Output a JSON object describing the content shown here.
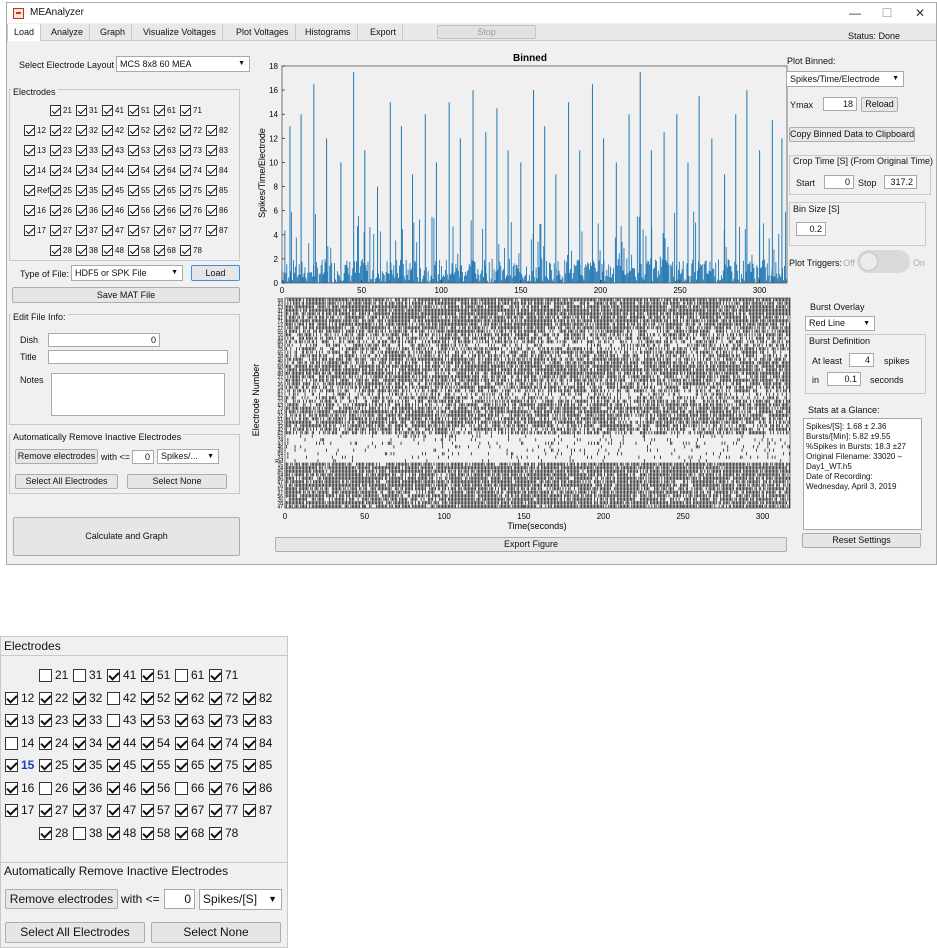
{
  "window": {
    "title": "MEAnalyzer",
    "minimize": "—",
    "maximize": "☐",
    "close": "✕",
    "status": "Status: Done",
    "stop_label": "Stop",
    "tabs": [
      "Load",
      "Analyze",
      "Graph",
      "Visualize Voltages",
      "Plot Voltages",
      "Histograms",
      "Export"
    ]
  },
  "left": {
    "layout_label": "Select Electrode Layout",
    "layout_value": "MCS 8x8 60 MEA",
    "electrodes_title": "Electrodes",
    "electrode_rows": [
      [
        {
          "l": "21",
          "c": true
        },
        {
          "l": "31",
          "c": true
        },
        {
          "l": "41",
          "c": true
        },
        {
          "l": "51",
          "c": true
        },
        {
          "l": "61",
          "c": true
        },
        {
          "l": "71",
          "c": true
        }
      ],
      [
        {
          "l": "12",
          "c": true
        },
        {
          "l": "22",
          "c": true
        },
        {
          "l": "32",
          "c": true
        },
        {
          "l": "42",
          "c": true
        },
        {
          "l": "52",
          "c": true
        },
        {
          "l": "62",
          "c": true
        },
        {
          "l": "72",
          "c": true
        },
        {
          "l": "82",
          "c": true
        }
      ],
      [
        {
          "l": "13",
          "c": true
        },
        {
          "l": "23",
          "c": true
        },
        {
          "l": "33",
          "c": true
        },
        {
          "l": "43",
          "c": true
        },
        {
          "l": "53",
          "c": true
        },
        {
          "l": "63",
          "c": true
        },
        {
          "l": "73",
          "c": true
        },
        {
          "l": "83",
          "c": true
        }
      ],
      [
        {
          "l": "14",
          "c": true
        },
        {
          "l": "24",
          "c": true
        },
        {
          "l": "34",
          "c": true
        },
        {
          "l": "44",
          "c": true
        },
        {
          "l": "54",
          "c": true
        },
        {
          "l": "64",
          "c": true
        },
        {
          "l": "74",
          "c": true
        },
        {
          "l": "84",
          "c": true
        }
      ],
      [
        {
          "l": "Ref",
          "c": true
        },
        {
          "l": "25",
          "c": true
        },
        {
          "l": "35",
          "c": true
        },
        {
          "l": "45",
          "c": true
        },
        {
          "l": "55",
          "c": true
        },
        {
          "l": "65",
          "c": true
        },
        {
          "l": "75",
          "c": true
        },
        {
          "l": "85",
          "c": true
        }
      ],
      [
        {
          "l": "16",
          "c": true
        },
        {
          "l": "26",
          "c": true
        },
        {
          "l": "36",
          "c": true
        },
        {
          "l": "46",
          "c": true
        },
        {
          "l": "56",
          "c": true
        },
        {
          "l": "66",
          "c": true
        },
        {
          "l": "76",
          "c": true
        },
        {
          "l": "86",
          "c": true
        }
      ],
      [
        {
          "l": "17",
          "c": true
        },
        {
          "l": "27",
          "c": true
        },
        {
          "l": "37",
          "c": true
        },
        {
          "l": "47",
          "c": true
        },
        {
          "l": "57",
          "c": true
        },
        {
          "l": "67",
          "c": true
        },
        {
          "l": "77",
          "c": true
        },
        {
          "l": "87",
          "c": true
        }
      ],
      [
        {
          "l": "28",
          "c": true
        },
        {
          "l": "38",
          "c": true
        },
        {
          "l": "48",
          "c": true
        },
        {
          "l": "58",
          "c": true
        },
        {
          "l": "68",
          "c": true
        },
        {
          "l": "78",
          "c": true
        }
      ]
    ],
    "file_type_label": "Type of File:",
    "file_type_value": "HDF5 or SPK File",
    "load_label": "Load",
    "save_mat_label": "Save MAT File",
    "edit_info_title": "Edit File Info:",
    "dish_label": "Dish",
    "dish_value": "0",
    "title_label": "Title",
    "notes_label": "Notes",
    "auto_remove_title": "Automatically Remove Inactive Electrodes",
    "remove_label": "Remove electrodes",
    "with_label": "with <=",
    "threshold_value": "0",
    "metric_value": "Spikes/...",
    "select_all_label": "Select All Electrodes",
    "select_none_label": "Select None",
    "calc_label": "Calculate and Graph"
  },
  "plot": {
    "export_label": "Export Figure"
  },
  "right": {
    "plot_binned_label": "Plot Binned:",
    "plot_binned_value": "Spikes/Time/Electrode",
    "ymax_label": "Ymax",
    "ymax_value": "18",
    "reload_label": "Reload",
    "copy_label": "Copy Binned Data to Clipboard",
    "crop_title": "Crop Time [S] (From Original Time)",
    "start_label": "Start",
    "start_value": "0",
    "stop_label": "Stop",
    "stop_value": "317.2",
    "bin_title": "Bin Size [S]",
    "bin_value": "0.2",
    "triggers_label": "Plot Triggers:",
    "off_label": "Off",
    "on_label": "On",
    "burst_overlay_label": "Burst Overlay",
    "burst_overlay_value": "Red Line",
    "burst_def_title": "Burst Definition",
    "at_least_label": "At least",
    "at_least_value": "4",
    "spikes_label": "spikes",
    "in_label": "in",
    "in_value": "0.1",
    "seconds_label": "seconds",
    "stats_title": "Stats at a Glance:",
    "stats_lines": [
      "Spikes/[S]: 1.68 ± 2.36",
      "Bursts/[Min]: 5.82 ±9.55",
      "%Spikes in Bursts: 18.3 ±27",
      "Original Filename: 33020 –",
      "Day1_WT.h5",
      "Date of Recording:",
      "Wednesday, April 3, 2019"
    ],
    "reset_label": "Reset Settings"
  },
  "zoom": {
    "electrodes_title": "Electrodes",
    "electrode_rows": [
      [
        {
          "l": "21",
          "c": false
        },
        {
          "l": "31",
          "c": false
        },
        {
          "l": "41",
          "c": true
        },
        {
          "l": "51",
          "c": true
        },
        {
          "l": "61",
          "c": false
        },
        {
          "l": "71",
          "c": true
        }
      ],
      [
        {
          "l": "12",
          "c": true
        },
        {
          "l": "22",
          "c": true
        },
        {
          "l": "32",
          "c": true
        },
        {
          "l": "42",
          "c": false
        },
        {
          "l": "52",
          "c": true
        },
        {
          "l": "62",
          "c": true
        },
        {
          "l": "72",
          "c": true
        },
        {
          "l": "82",
          "c": true
        }
      ],
      [
        {
          "l": "13",
          "c": true
        },
        {
          "l": "23",
          "c": true
        },
        {
          "l": "33",
          "c": true
        },
        {
          "l": "43",
          "c": false
        },
        {
          "l": "53",
          "c": true
        },
        {
          "l": "63",
          "c": true
        },
        {
          "l": "73",
          "c": true
        },
        {
          "l": "83",
          "c": true
        }
      ],
      [
        {
          "l": "14",
          "c": false
        },
        {
          "l": "24",
          "c": true
        },
        {
          "l": "34",
          "c": true
        },
        {
          "l": "44",
          "c": true
        },
        {
          "l": "54",
          "c": true
        },
        {
          "l": "64",
          "c": true
        },
        {
          "l": "74",
          "c": true
        },
        {
          "l": "84",
          "c": true
        }
      ],
      [
        {
          "l": "15",
          "c": true
        },
        {
          "l": "25",
          "c": true
        },
        {
          "l": "35",
          "c": true
        },
        {
          "l": "45",
          "c": true
        },
        {
          "l": "55",
          "c": true
        },
        {
          "l": "65",
          "c": true
        },
        {
          "l": "75",
          "c": true
        },
        {
          "l": "85",
          "c": true
        }
      ],
      [
        {
          "l": "16",
          "c": true
        },
        {
          "l": "26",
          "c": false
        },
        {
          "l": "36",
          "c": true
        },
        {
          "l": "46",
          "c": true
        },
        {
          "l": "56",
          "c": true
        },
        {
          "l": "66",
          "c": false
        },
        {
          "l": "76",
          "c": true
        },
        {
          "l": "86",
          "c": true
        }
      ],
      [
        {
          "l": "17",
          "c": true
        },
        {
          "l": "27",
          "c": true
        },
        {
          "l": "37",
          "c": true
        },
        {
          "l": "47",
          "c": true
        },
        {
          "l": "57",
          "c": true
        },
        {
          "l": "67",
          "c": true
        },
        {
          "l": "77",
          "c": true
        },
        {
          "l": "87",
          "c": true
        }
      ],
      [
        {
          "l": "28",
          "c": true
        },
        {
          "l": "38",
          "c": false
        },
        {
          "l": "48",
          "c": true
        },
        {
          "l": "58",
          "c": true
        },
        {
          "l": "68",
          "c": true
        },
        {
          "l": "78",
          "c": true
        }
      ]
    ],
    "auto_remove_title": "Automatically Remove Inactive Electrodes",
    "remove_label": "Remove electrodes",
    "with_label": "with <=",
    "threshold_value": "0",
    "metric_value": "Spikes/[S]",
    "select_all_label": "Select All Electrodes",
    "select_none_label": "Select None"
  },
  "colors": {
    "binned_bars": "#1f77b4",
    "raster": "#000000",
    "highlight_label": "#1a3fc0",
    "focus_border": "#3a8ee6"
  },
  "chart_data": [
    {
      "type": "bar",
      "title": "Binned",
      "ylabel": "Spikes/Time/Electrode",
      "xlim": [
        0,
        317.2
      ],
      "ylim": [
        0,
        18
      ],
      "x_ticks": [
        0,
        50,
        100,
        150,
        200,
        250,
        300
      ],
      "y_ticks": [
        0,
        2,
        4,
        6,
        8,
        10,
        12,
        14,
        16,
        18
      ],
      "bin_size": 0.2,
      "peaks": [
        {
          "x": 5,
          "y": 13
        },
        {
          "x": 12,
          "y": 14
        },
        {
          "x": 20,
          "y": 16.5
        },
        {
          "x": 28,
          "y": 12
        },
        {
          "x": 37,
          "y": 10
        },
        {
          "x": 45,
          "y": 17.5
        },
        {
          "x": 52,
          "y": 11
        },
        {
          "x": 60,
          "y": 8
        },
        {
          "x": 68,
          "y": 15
        },
        {
          "x": 75,
          "y": 13
        },
        {
          "x": 82,
          "y": 9
        },
        {
          "x": 90,
          "y": 14
        },
        {
          "x": 97,
          "y": 10
        },
        {
          "x": 105,
          "y": 15
        },
        {
          "x": 112,
          "y": 12
        },
        {
          "x": 120,
          "y": 16
        },
        {
          "x": 128,
          "y": 12.5
        },
        {
          "x": 135,
          "y": 14.5
        },
        {
          "x": 142,
          "y": 11
        },
        {
          "x": 150,
          "y": 10
        },
        {
          "x": 158,
          "y": 16
        },
        {
          "x": 165,
          "y": 13
        },
        {
          "x": 172,
          "y": 9
        },
        {
          "x": 180,
          "y": 15
        },
        {
          "x": 187,
          "y": 11
        },
        {
          "x": 195,
          "y": 16.5
        },
        {
          "x": 202,
          "y": 12
        },
        {
          "x": 210,
          "y": 10
        },
        {
          "x": 218,
          "y": 14
        },
        {
          "x": 225,
          "y": 17.5
        },
        {
          "x": 232,
          "y": 11
        },
        {
          "x": 240,
          "y": 12.5
        },
        {
          "x": 248,
          "y": 14
        },
        {
          "x": 255,
          "y": 10
        },
        {
          "x": 262,
          "y": 15.5
        },
        {
          "x": 270,
          "y": 12
        },
        {
          "x": 278,
          "y": 9
        },
        {
          "x": 285,
          "y": 14
        },
        {
          "x": 292,
          "y": 16
        },
        {
          "x": 300,
          "y": 11
        },
        {
          "x": 308,
          "y": 13.5
        },
        {
          "x": 314,
          "y": 12
        }
      ],
      "baseline_range": [
        0,
        2
      ]
    },
    {
      "type": "scatter",
      "subtype": "raster",
      "xlabel": "Time(seconds)",
      "ylabel": "Electrode Number",
      "xlim": [
        0,
        317.2
      ],
      "x_ticks": [
        0,
        50,
        100,
        150,
        200,
        250,
        300
      ],
      "electrodes": [
        "47",
        "78",
        "26",
        "56",
        "37",
        "57",
        "76",
        "67",
        "86",
        "54",
        "85",
        "24",
        "15",
        "Ref",
        "34",
        "64",
        "48",
        "46",
        "43",
        "74",
        "53",
        "62",
        "42",
        "32",
        "52",
        "51",
        "22",
        "61",
        "73",
        "63",
        "72",
        "23",
        "82",
        "87",
        "14",
        "36",
        "77",
        "27",
        "88",
        "35",
        "68",
        "25",
        "45",
        "28",
        "65",
        "75",
        "83",
        "66",
        "44",
        "16",
        "55",
        "17",
        "12",
        "71",
        "41",
        "21",
        "31",
        "13",
        "33",
        "58"
      ],
      "density": [
        0.85,
        0.9,
        0.8,
        0.85,
        0.8,
        0.75,
        0.85,
        0.8,
        0.85,
        0.8,
        0.85,
        0.9,
        0.85,
        0.05,
        0.1,
        0.08,
        0.12,
        0.1,
        0.15,
        0.1,
        0.12,
        0.6,
        0.65,
        0.7,
        0.75,
        0.7,
        0.75,
        0.8,
        0.75,
        0.7,
        0.6,
        0.5,
        0.4,
        0.55,
        0.6,
        0.65,
        0.7,
        0.75,
        0.8,
        0.85,
        0.8,
        0.75,
        0.7,
        0.65,
        0.6,
        0.55,
        0.5,
        0.55,
        0.6,
        0.65,
        0.7,
        0.75,
        0.8,
        0.85,
        0.8,
        0.85,
        0.9,
        0.85,
        0.8,
        0.85
      ]
    }
  ]
}
